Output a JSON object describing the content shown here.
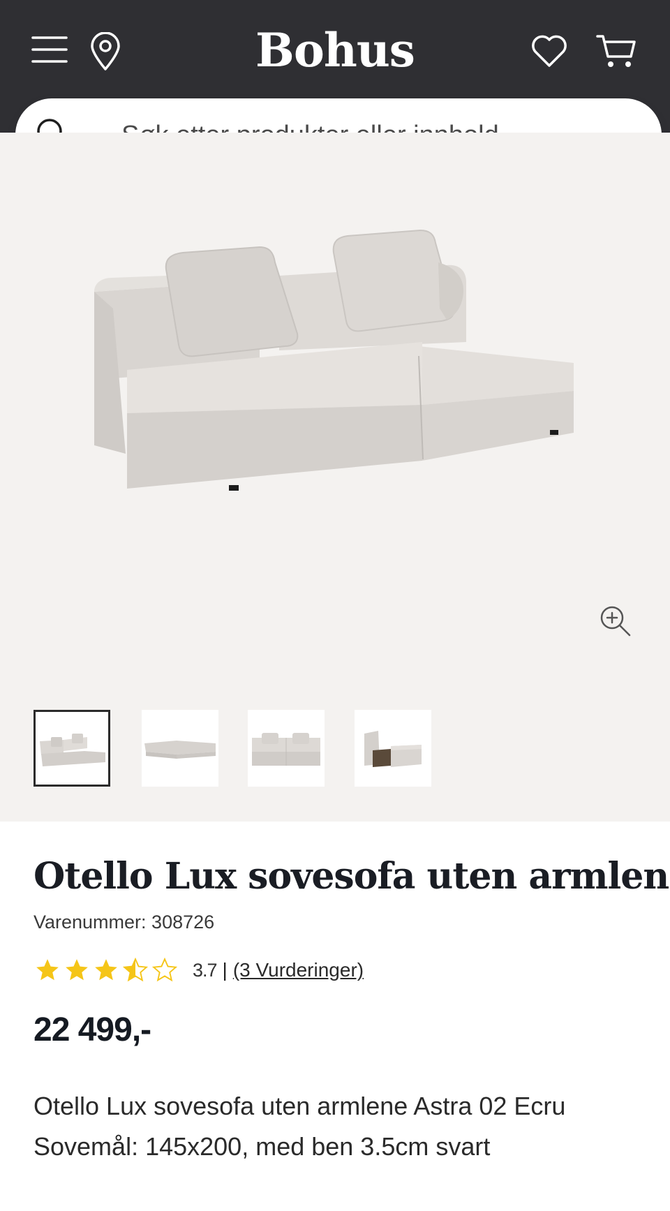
{
  "header": {
    "logo": "Bohus",
    "icons": [
      "menu-icon",
      "location-pin-icon",
      "heart-icon",
      "cart-icon"
    ]
  },
  "search": {
    "placeholder": "Søk etter produkter eller innhold..."
  },
  "gallery": {
    "thumbnails_count": 4,
    "active_thumbnail": 1
  },
  "product": {
    "title": "Otello Lux sovesofa uten armlene",
    "sku_label": "Varenummer: 308726",
    "rating_value": "3.7",
    "rating_score": 3.7,
    "rating_separator": "|",
    "reviews_text": "(3 Vurderinger)",
    "price": "22 499,-",
    "description_line1": "Otello Lux sovesofa uten armlene Astra 02 Ecru",
    "description_line2": "Sovemål: 145x200, med ben 3.5cm svart"
  },
  "colors": {
    "header_bg": "#2f2f33",
    "gallery_bg": "#f4f2f0",
    "star": "#f5c518",
    "text_dark": "#1a1d24"
  }
}
